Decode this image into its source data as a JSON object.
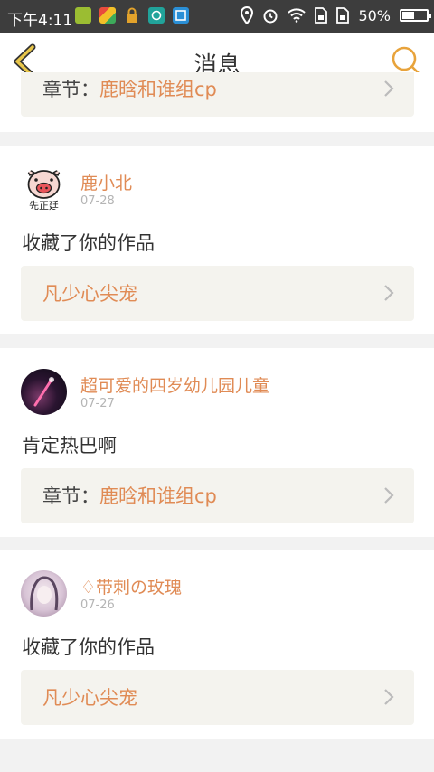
{
  "status_bar": {
    "time": "下午4:11",
    "battery_percent": "50%",
    "battery_level": 0.5,
    "left_icons": [
      "green-app-icon",
      "multicolor-app-icon",
      "lock-icon",
      "teal-app-icon",
      "blue-app-icon"
    ],
    "right_icons": [
      "location-icon",
      "alarm-icon",
      "wifi-icon",
      "sim-icon",
      "sim-icon",
      "battery-icon"
    ]
  },
  "header": {
    "title": "消息",
    "back_icon": "chevron-left-icon",
    "search_icon": "search-icon",
    "accent_color": "#e8a33b"
  },
  "colors": {
    "accent": "#e08b55",
    "ref_bg": "#f4f3ee",
    "page_bg": "#f2f2f2"
  },
  "notifications": [
    {
      "ref_prefix": "章节：",
      "ref_link": "鹿晗和谁组cp"
    },
    {
      "username": "鹿小北",
      "date": "07-28",
      "message": "收藏了你的作品",
      "ref_prefix": "",
      "ref_link": "凡少心尖宠",
      "avatar_text": "先正廷"
    },
    {
      "username": "超可爱的四岁幼儿园儿童",
      "date": "07-27",
      "message": "肯定热巴啊",
      "ref_prefix": "章节：",
      "ref_link": "鹿晗和谁组cp"
    },
    {
      "username": "♢带刺の玫瑰",
      "date": "07-26",
      "message": "收藏了你的作品",
      "ref_prefix": "",
      "ref_link": "凡少心尖宠"
    }
  ]
}
